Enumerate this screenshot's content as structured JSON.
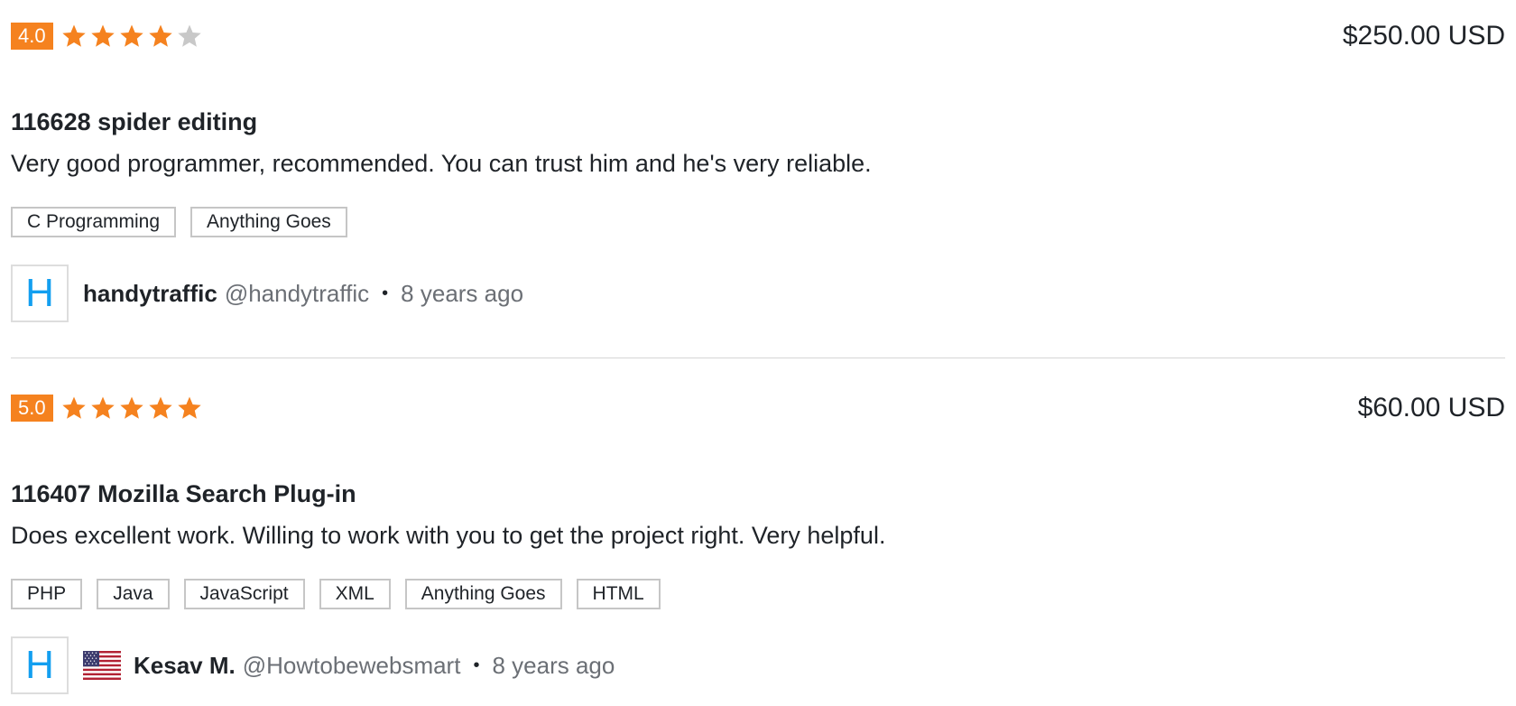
{
  "colors": {
    "accent": "#f5821f",
    "star_filled": "#f5821f",
    "star_empty": "#c8c8c8",
    "avatar_letter": "#139ff0",
    "divider": "#d6d6d6"
  },
  "reviews": [
    {
      "rating": "4.0",
      "stars_filled": 4,
      "stars_total": 5,
      "price": "$250.00 USD",
      "project_title": "116628 spider editing",
      "text": "Very good programmer, recommended. You can trust him and he's very reliable.",
      "skills": [
        "C Programming",
        "Anything Goes"
      ],
      "author": {
        "avatar_letter": "H",
        "has_flag": false,
        "name": "handytraffic",
        "handle": "@handytraffic",
        "separator": "•",
        "time_ago": "8 years ago"
      }
    },
    {
      "rating": "5.0",
      "stars_filled": 5,
      "stars_total": 5,
      "price": "$60.00 USD",
      "project_title": "116407 Mozilla Search Plug-in",
      "text": "Does excellent work. Willing to work with you to get the project right. Very helpful.",
      "skills": [
        "PHP",
        "Java",
        "JavaScript",
        "XML",
        "Anything Goes",
        "HTML"
      ],
      "author": {
        "avatar_letter": "H",
        "has_flag": true,
        "flag_icon": "us-flag-icon",
        "name": "Kesav M.",
        "handle": "@Howtobewebsmart",
        "separator": "•",
        "time_ago": "8 years ago"
      }
    }
  ]
}
